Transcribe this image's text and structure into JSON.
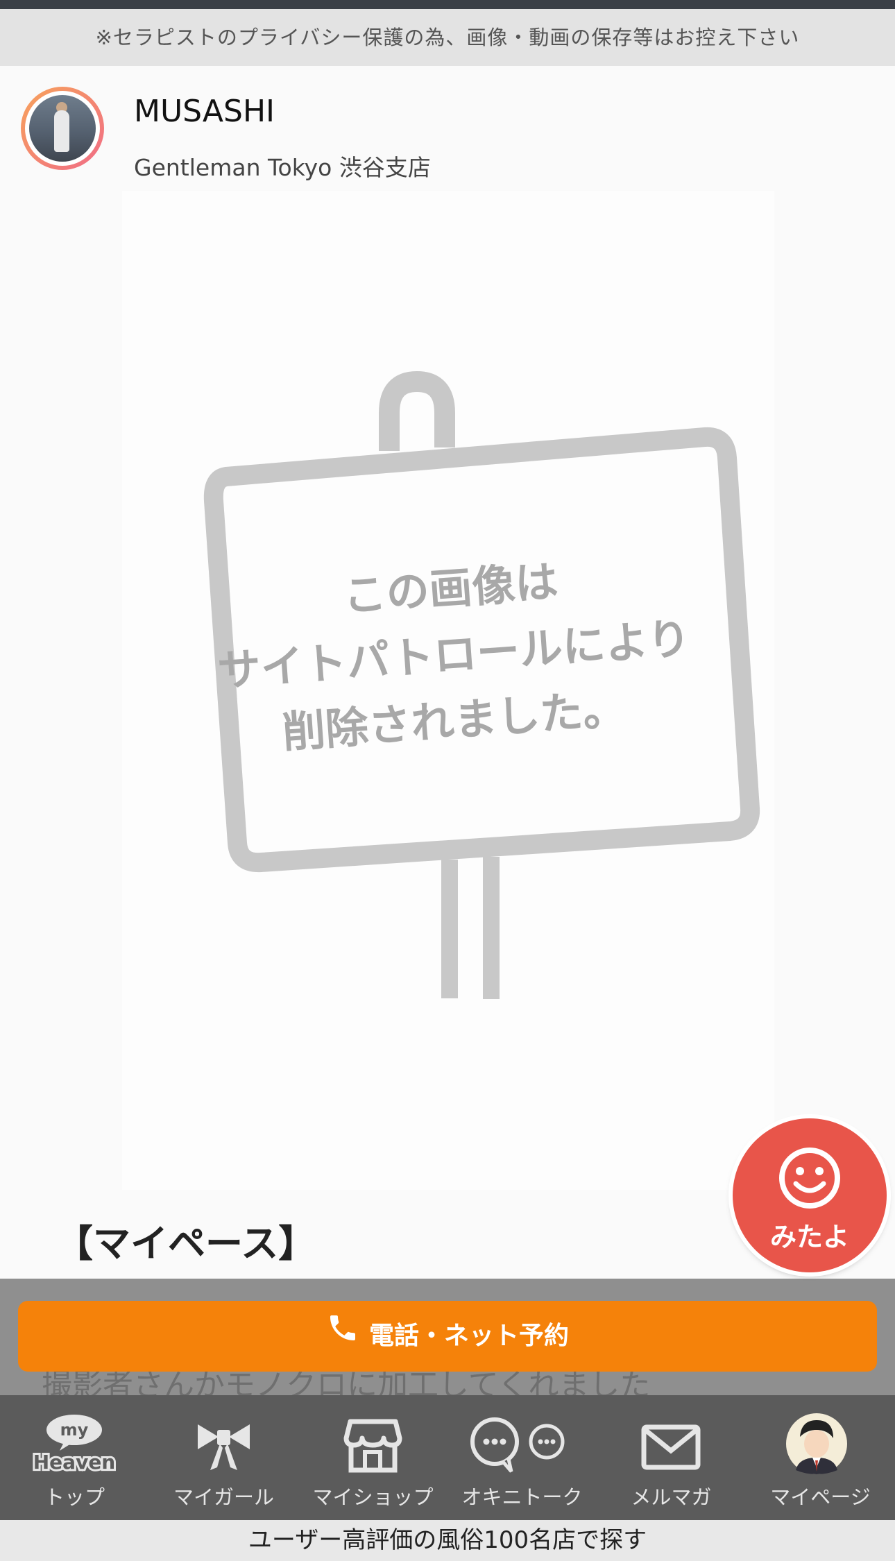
{
  "notice": "※セラピストのプライバシー保護の為、画像・動画の保存等はお控え下さい",
  "profile": {
    "name": "MUSASHI",
    "shop": "Gentleman Tokyo 渋谷支店"
  },
  "photo": {
    "removed_lines": [
      "この画像は",
      "サイトパトロールにより",
      "削除されました。"
    ]
  },
  "post": {
    "title": "【マイペース】",
    "body_partial": "撮影者さんかモノクロに加工してくれました"
  },
  "reserve_button": "電話・ネット予約",
  "mitayo_button": "みたよ",
  "tabs": [
    {
      "label": "トップ",
      "icon": "my-heaven-logo-icon",
      "icon_text_top": "my",
      "icon_text_bottom": "Heaven"
    },
    {
      "label": "マイガール",
      "icon": "ribbon-icon"
    },
    {
      "label": "マイショップ",
      "icon": "shop-icon"
    },
    {
      "label": "オキニトーク",
      "icon": "chat-bubbles-icon"
    },
    {
      "label": "メルマガ",
      "icon": "mail-icon"
    },
    {
      "label": "マイページ",
      "icon": "user-avatar-icon"
    }
  ],
  "footer": "ユーザー高評価の風俗100名店で探す",
  "colors": {
    "reserve": "#f5820a",
    "mitayo": "#e8554a",
    "tabbar": "#5b5b5b",
    "notice_bg": "#e3e3e3"
  }
}
